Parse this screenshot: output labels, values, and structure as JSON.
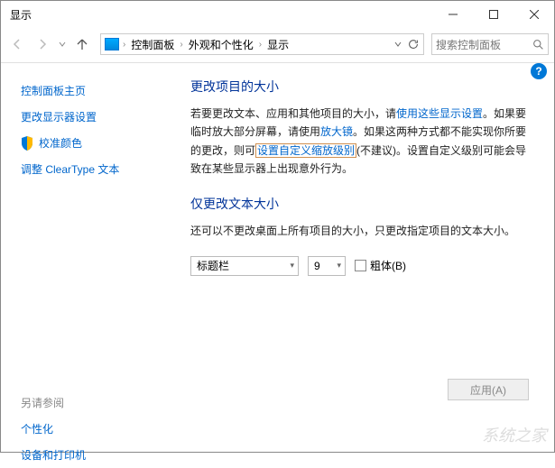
{
  "window": {
    "title": "显示"
  },
  "breadcrumb": {
    "a": "控制面板",
    "b": "外观和个性化",
    "c": "显示"
  },
  "search": {
    "placeholder": "搜索控制面板"
  },
  "sidebar": {
    "home": "控制面板主页",
    "items": [
      "更改显示器设置",
      "校准颜色",
      "调整 ClearType 文本"
    ],
    "see_also_label": "另请参阅",
    "see_also": [
      "个性化",
      "设备和打印机"
    ]
  },
  "section1": {
    "heading": "更改项目的大小",
    "t1": "若要更改文本、应用和其他项目的大小，请",
    "link1": "使用这些显示设置",
    "t2": "。如果要临时放大部分屏幕，请使用",
    "link2": "放大镜",
    "t3": "。如果这两种方式都不能实现你所要的更改，则可",
    "link3": "设置自定义缩放级别",
    "t4": "(不建议)。设置自定义级别可能会导致在某些显示器上出现意外行为。"
  },
  "section2": {
    "heading": "仅更改文本大小",
    "desc": "还可以不更改桌面上所有项目的大小，只更改指定项目的文本大小。",
    "select_item": "标题栏",
    "select_size": "9",
    "bold_label": "粗体(B)"
  },
  "apply_label": "应用(A)",
  "watermark": "系统之家"
}
